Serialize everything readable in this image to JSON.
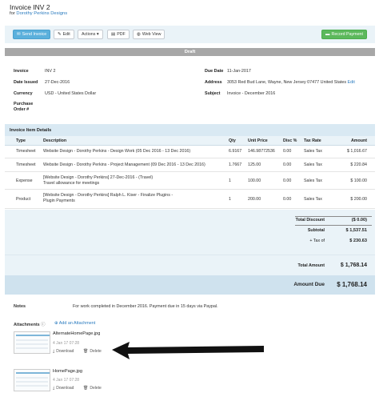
{
  "header": {
    "title": "Invoice INV 2",
    "for_prefix": "for",
    "client": "Dorothy Perkins Designs"
  },
  "toolbar": {
    "send_invoice": "Send Invoice",
    "edit": "Edit",
    "actions": "Actions",
    "pdf": "PDF",
    "web_view": "Web View",
    "record_payment": "Record Payment"
  },
  "status": "Draft",
  "details": {
    "invoice_label": "Invoice",
    "invoice_value": "INV 2",
    "date_issued_label": "Date Issued",
    "date_issued_value": "27-Dec-2016",
    "currency_label": "Currency",
    "currency_value": "USD - United States Dollar",
    "po_label_1": "Purchase",
    "po_label_2": "Order #",
    "due_date_label": "Due Date",
    "due_date_value": "11-Jan-2017",
    "address_label": "Address",
    "address_value": "3053 Red Bud Lane, Wayne, New Jersey 07477 United States",
    "address_edit": "Edit",
    "subject_label": "Subject",
    "subject_value": "Invoice - December 2016"
  },
  "items": {
    "section_title": "Invoice Item Details",
    "columns": {
      "type": "Type",
      "description": "Description",
      "qty": "Qty",
      "unit_price": "Unit Price",
      "disc": "Disc %",
      "tax_rate": "Tax Rate",
      "amount": "Amount"
    },
    "rows": [
      {
        "type": "Timesheet",
        "desc1": "Website Design - Dorothy Perkins - Design Work (05 Dec 2016 - 13 Dec 2016)",
        "desc2": "",
        "qty": "6.9167",
        "unit_price": "146.98772536",
        "disc": "0.00",
        "tax_rate": "Sales Tax",
        "amount": "$ 1,016.67"
      },
      {
        "type": "Timesheet",
        "desc1": "Website Design - Dorothy Perkins - Project Management (09 Dec 2016 - 13 Dec 2016)",
        "desc2": "",
        "qty": "1.7667",
        "unit_price": "125.00",
        "disc": "0.00",
        "tax_rate": "Sales Tax",
        "amount": "$ 220.84"
      },
      {
        "type": "Expense",
        "desc1": "[Website Design - Dorothy Perkins] 27-Dec-2016 - (Travel)",
        "desc2": "Travel allowance for meetings",
        "qty": "1",
        "unit_price": "100.00",
        "disc": "0.00",
        "tax_rate": "Sales Tax",
        "amount": "$ 100.00"
      },
      {
        "type": "Product",
        "desc1": "[Website Design - Dorothy Perkins] Ralph L. Kiser - Finalize Plugins -",
        "desc2": "Plugin Payments",
        "qty": "1",
        "unit_price": "200.00",
        "disc": "0.00",
        "tax_rate": "Sales Tax",
        "amount": "$ 200.00"
      }
    ]
  },
  "totals": {
    "total_discount_label": "Total Discount",
    "total_discount_value": "($ 0.00)",
    "subtotal_label": "Subtotal",
    "subtotal_value": "$ 1,537.51",
    "tax_label": "+ Tax of",
    "tax_value": "$ 230.63",
    "total_amount_label": "Total Amount",
    "total_amount_value": "$ 1,768.14",
    "amount_due_label": "Amount Due",
    "amount_due_value": "$ 1,768.14"
  },
  "notes": {
    "label": "Notes",
    "value": "For work completed in December 2016. Payment due in 15 days via Paypal."
  },
  "attachments": {
    "label": "Attachments",
    "add_label": "Add an Attachment",
    "files": [
      {
        "name": "AlternateHomePage.jpg",
        "date": "4 Jan 17 07:28",
        "download": "Download",
        "delete": "Delete"
      },
      {
        "name": "HomePage.jpg",
        "date": "4 Jan 17 07:28",
        "download": "Download",
        "delete": "Delete"
      }
    ]
  },
  "colors": {
    "link": "#2a7bbf",
    "primary": "#5bb0dc",
    "success": "#5cb85c",
    "status_gray": "#a7a7a7",
    "band": "#eaf3f8"
  }
}
